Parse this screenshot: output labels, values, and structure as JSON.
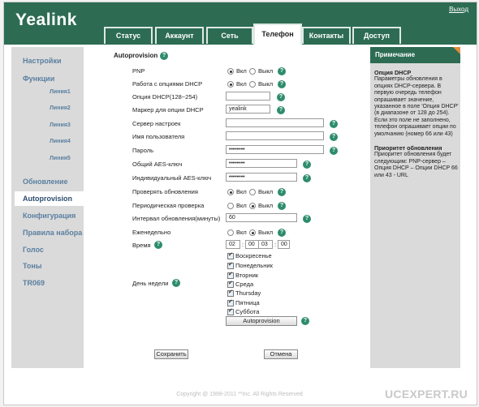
{
  "header": {
    "logo": "Yealink",
    "logout": "Выход",
    "tabs": [
      "Статус",
      "Аккаунт",
      "Сеть",
      "Телефон",
      "Контакты",
      "Доступ"
    ],
    "active_tab": "Телефон"
  },
  "sidebar": {
    "items": [
      {
        "label": "Настройки"
      },
      {
        "label": "Функции"
      },
      {
        "label": "Линия1"
      },
      {
        "label": "Линия2"
      },
      {
        "label": "Линия3"
      },
      {
        "label": "Линия4"
      },
      {
        "label": "Линия5"
      },
      {
        "label": "Обновление"
      },
      {
        "label": "Autoprovision"
      },
      {
        "label": "Конфигурация"
      },
      {
        "label": "Правила набора"
      },
      {
        "label": "Голос"
      },
      {
        "label": "Тоны"
      },
      {
        "label": "TR069"
      }
    ],
    "active": "Autoprovision"
  },
  "form": {
    "title": "Autoprovision",
    "pnp_label": "PNP",
    "pnp_value": "Вкл",
    "dhcp_label": "Работа с опциями DHCP",
    "dhcp_value": "Вкл",
    "dhcp_option_label": "Опция DHCP(128~254)",
    "dhcp_option_value": "",
    "dhcp_marker_label": "Маркер для опции DHCP",
    "dhcp_marker_value": "yealink",
    "server_label": "Сервер настроек",
    "server_value": "",
    "username_label": "Имя пользователя",
    "username_value": "",
    "password_label": "Пароль",
    "password_value": "••••••••",
    "common_aes_label": "Общий AES-ключ",
    "common_aes_value": "••••••••",
    "individual_aes_label": "Индивидуальный AES-ключ",
    "individual_aes_value": "••••••••",
    "check_updates_label": "Проверять обновления",
    "check_updates_value": "Вкл",
    "periodic_label": "Периодическая проверка",
    "periodic_value": "Выкл",
    "interval_label": "Интервал обновления(минуты)",
    "interval_value": "60",
    "weekly_label": "Еженедельно",
    "weekly_value": "Выкл",
    "time_label": "Время",
    "time_values": [
      "02",
      "00",
      "03",
      "00"
    ],
    "day_label": "День недели",
    "days": [
      "Воскресенье",
      "Понедельник",
      "Вторник",
      "Среда",
      "Thursday",
      "Пятница",
      "Суббота"
    ],
    "on_label": "Вкл",
    "off_label": "Выкл",
    "autoprovision_button": "Autoprovision",
    "save_button": "Сохранить",
    "cancel_button": "Отмена"
  },
  "note": {
    "title": "Примечание",
    "section1_title": "Опция DHCP",
    "section1_text": "Параметры обновления в опциях DHCP-сервера. В первую очередь телефон опрашивает значение, указанное в поле 'Опция DHCP' (в диапазоне от 128 до 254). Если это поле не заполнено, телефон опрашивает опции по умолчанию (номер 66 или 43)",
    "section2_title": "Приоритет обновления",
    "section2_text": "Приоритет обновления будет следующим: PNP-сервер – Опция DHCP – Опции DHCP 66 или 43 - URL"
  },
  "footer": "Copyright @ 1998-2011 **Inc. All Rights Reserved",
  "watermark": "UCEXPERT.RU"
}
